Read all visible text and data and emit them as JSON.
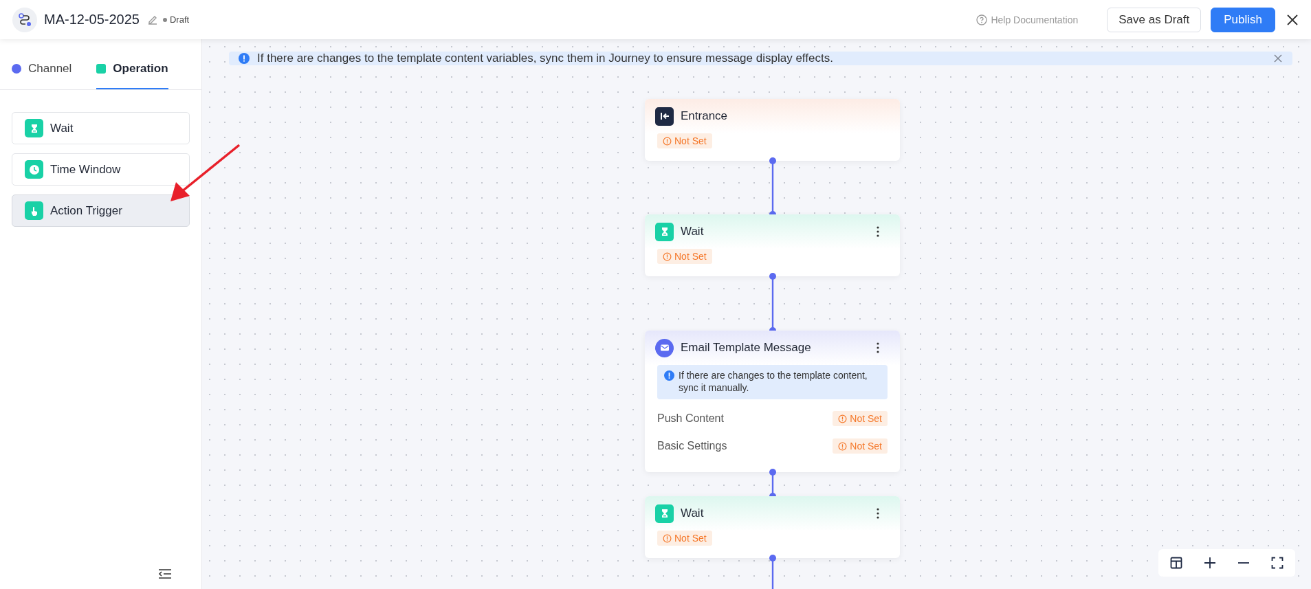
{
  "header": {
    "title": "MA-12-05-2025",
    "status": "Draft",
    "help": "Help Documentation",
    "buttons": [
      {
        "label": "Save as Draft",
        "kind": "secondary"
      },
      {
        "label": "Publish",
        "kind": "primary"
      }
    ]
  },
  "sidebar": {
    "tabs": [
      {
        "label": "Channel",
        "color": "#5b6af0",
        "selected": false
      },
      {
        "label": "Operation",
        "color": "#19d1a6",
        "selected": true
      }
    ],
    "items": [
      {
        "label": "Wait",
        "kind": "wait",
        "selected": false
      },
      {
        "label": "Time Window",
        "kind": "time_window",
        "selected": false
      },
      {
        "label": "Action Trigger",
        "kind": "action_trigger",
        "selected": true
      }
    ]
  },
  "banner": {
    "text": "If there are changes to the template content variables, sync them in Journey to ensure message display effects."
  },
  "nodes": [
    {
      "kind": "entrance",
      "title": "Entrance",
      "menu": false,
      "status": "Not Set"
    },
    {
      "kind": "wait",
      "title": "Wait",
      "menu": true,
      "status": "Not Set"
    },
    {
      "kind": "email",
      "title": "Email Template Message",
      "menu": true,
      "note": "If there are changes to the template content, sync it manually.",
      "fields": [
        {
          "label": "Push Content",
          "status": "Not Set"
        },
        {
          "label": "Basic Settings",
          "status": "Not Set"
        }
      ]
    },
    {
      "kind": "wait",
      "title": "Wait",
      "menu": true,
      "status": "Not Set"
    }
  ]
}
